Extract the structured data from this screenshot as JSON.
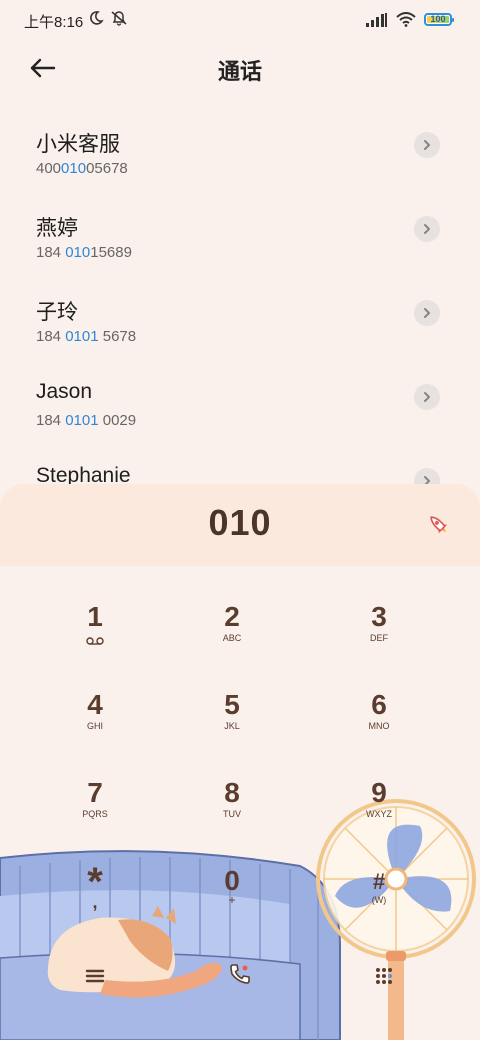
{
  "status_bar": {
    "time": "上午8:16",
    "battery": "100"
  },
  "header": {
    "title": "通话"
  },
  "contacts": [
    {
      "name": "小米客服",
      "number_pre": "400",
      "number_hl": "010",
      "number_post": "05678"
    },
    {
      "name": "燕婷",
      "number_pre": "184 ",
      "number_hl": "010",
      "number_post": "15689"
    },
    {
      "name": "子玲",
      "number_pre": "184 ",
      "number_hl": "0101",
      "number_post": " 5678"
    },
    {
      "name": "Jason",
      "number_pre": "184 ",
      "number_hl": "0101",
      "number_post": " 0029"
    },
    {
      "name": "Stephanie",
      "number_pre": "",
      "number_hl": "",
      "number_post": ""
    }
  ],
  "dialer": {
    "input": "010"
  },
  "keypad": {
    "keys": [
      {
        "digit": "1",
        "letters": ""
      },
      {
        "digit": "2",
        "letters": "ABC"
      },
      {
        "digit": "3",
        "letters": "DEF"
      },
      {
        "digit": "4",
        "letters": "GHI"
      },
      {
        "digit": "5",
        "letters": "JKL"
      },
      {
        "digit": "6",
        "letters": "MNO"
      },
      {
        "digit": "7",
        "letters": "PQRS"
      },
      {
        "digit": "8",
        "letters": "TUV"
      },
      {
        "digit": "9",
        "letters": "WXYZ"
      },
      {
        "digit": "*",
        "letters": ","
      },
      {
        "digit": "0",
        "letters": "+"
      },
      {
        "digit": "#",
        "letters": "(W)"
      }
    ]
  },
  "icons": {
    "back": "arrow-left-icon",
    "chevron": "chevron-right-icon",
    "rocket": "rocket-icon",
    "voicemail": "voicemail-icon",
    "menu": "menu-icon",
    "call": "phone-icon",
    "dialpad": "dialpad-icon"
  },
  "colors": {
    "accent": "#2f86d6",
    "key_text": "#5a3d2e",
    "background": "#fbf1ec",
    "display_bg": "#fbe9de"
  }
}
